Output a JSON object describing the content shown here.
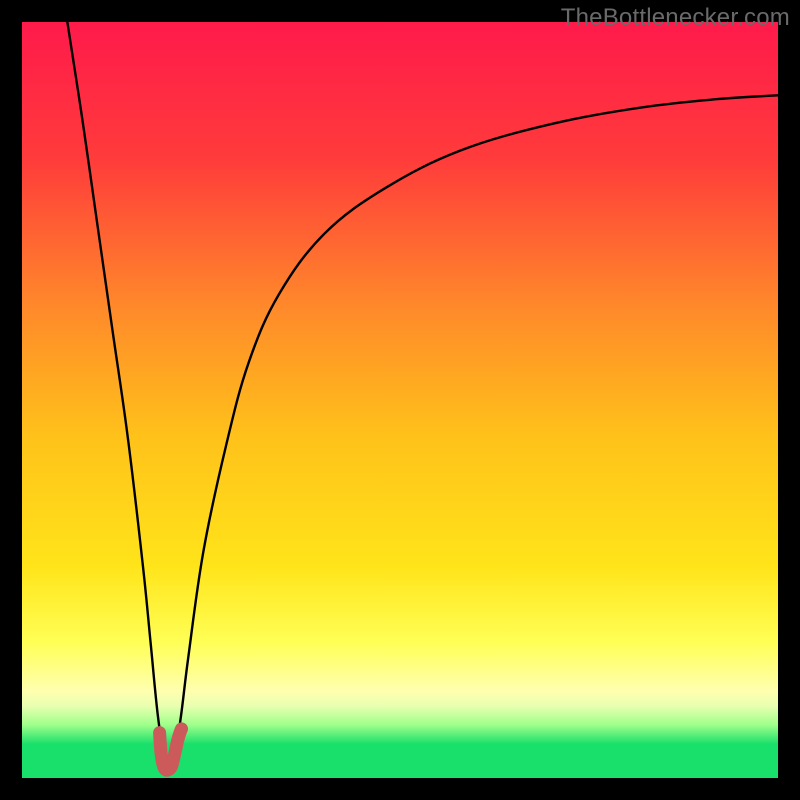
{
  "watermark": "TheBottlenecker.com",
  "colors": {
    "top": "#ff1a4b",
    "upper_mid": "#ff5a2e",
    "mid": "#ffb81a",
    "lower_mid": "#ffe41a",
    "pale_band": "#ffff9a",
    "green": "#19e06a",
    "curve": "#000000",
    "marker": "#cc5a5a",
    "frame": "#000000"
  },
  "chart_data": {
    "type": "line",
    "title": "",
    "xlabel": "",
    "ylabel": "",
    "xlim": [
      0,
      100
    ],
    "ylim": [
      0,
      100
    ],
    "gradient_stops": [
      {
        "pos": 0.0,
        "color": "#ff1a4b"
      },
      {
        "pos": 0.18,
        "color": "#ff3b3b"
      },
      {
        "pos": 0.38,
        "color": "#ff8a2a"
      },
      {
        "pos": 0.55,
        "color": "#ffc21a"
      },
      {
        "pos": 0.72,
        "color": "#ffe41a"
      },
      {
        "pos": 0.82,
        "color": "#ffff55"
      },
      {
        "pos": 0.885,
        "color": "#ffffb0"
      },
      {
        "pos": 0.905,
        "color": "#e8ffb0"
      },
      {
        "pos": 0.93,
        "color": "#9eff8a"
      },
      {
        "pos": 0.955,
        "color": "#19e06a"
      },
      {
        "pos": 1.0,
        "color": "#19e06a"
      }
    ],
    "optimum_x": 19,
    "series": [
      {
        "name": "bottleneck-curve",
        "x": [
          6,
          8,
          10,
          12,
          14,
          16,
          17,
          18,
          19,
          20,
          21,
          22,
          24,
          27,
          30,
          34,
          40,
          48,
          58,
          70,
          82,
          92,
          100
        ],
        "values": [
          100,
          87,
          73,
          59,
          45,
          28,
          18,
          8,
          2,
          2,
          8,
          16,
          30,
          44,
          55,
          64,
          72,
          78,
          83,
          86.5,
          88.7,
          89.8,
          90.3
        ]
      }
    ],
    "marker": {
      "name": "optimum-marker",
      "x": [
        18.2,
        18.4,
        18.7,
        19.0,
        19.4,
        19.8,
        20.2,
        20.6,
        20.9,
        21.1
      ],
      "values": [
        6.0,
        3.2,
        1.6,
        1.1,
        1.1,
        1.6,
        3.2,
        5.0,
        6.0,
        6.5
      ]
    }
  }
}
